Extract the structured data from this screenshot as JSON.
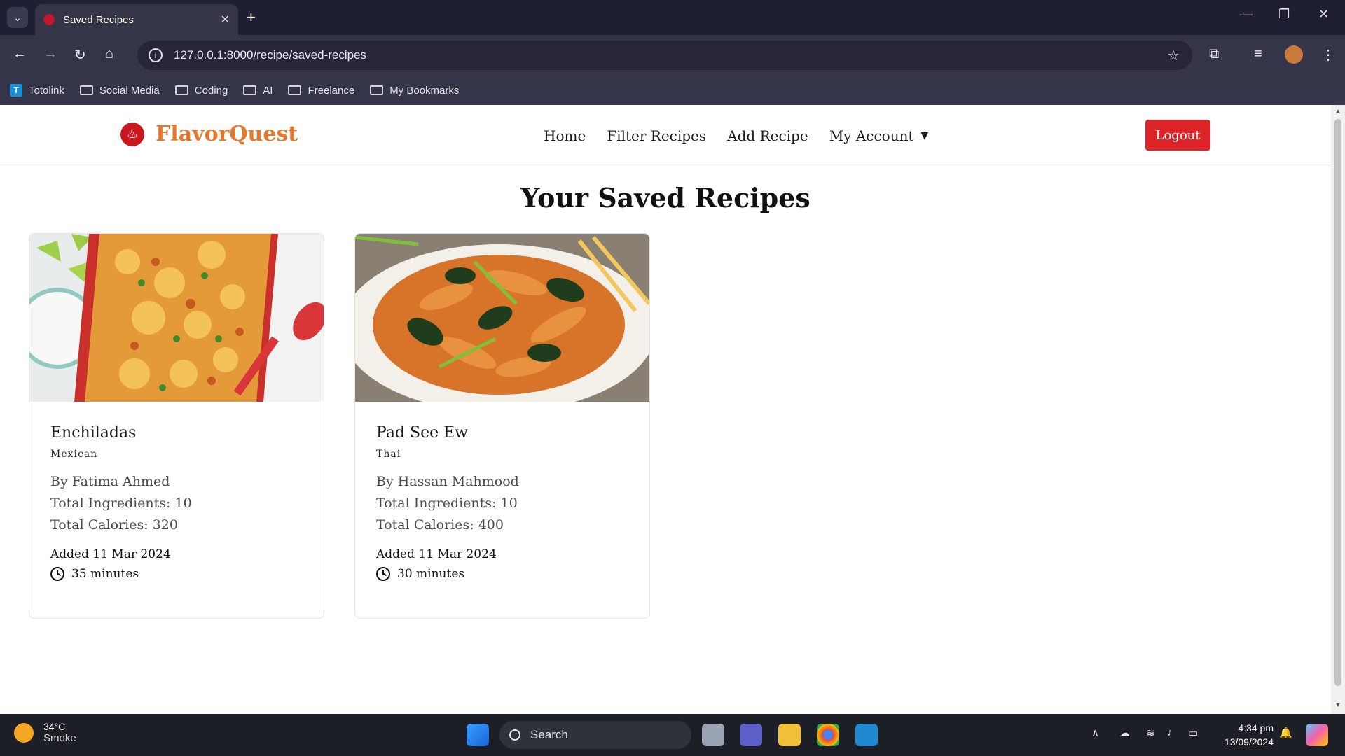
{
  "browser": {
    "tab_title": "Saved Recipes",
    "url": "127.0.0.1:8000/recipe/saved-recipes",
    "bookmarks": [
      {
        "label": "Totolink",
        "icon": "totolink-icon"
      },
      {
        "label": "Social Media",
        "icon": "folder-icon"
      },
      {
        "label": "Coding",
        "icon": "folder-icon"
      },
      {
        "label": "AI",
        "icon": "folder-icon"
      },
      {
        "label": "Freelance",
        "icon": "folder-icon"
      },
      {
        "label": "My Bookmarks",
        "icon": "folder-icon"
      }
    ]
  },
  "site": {
    "brand": "FlavorQuest",
    "brand_color": "#e8762c",
    "nav": {
      "home": "Home",
      "filter": "Filter Recipes",
      "add": "Add Recipe",
      "account": "My Account"
    },
    "logout": "Logout",
    "logout_color": "#dc2327"
  },
  "main": {
    "title": "Your Saved Recipes",
    "recipes": [
      {
        "name": "Enchiladas",
        "cuisine": "Mexican",
        "author": "By Fatima Ahmed",
        "ingredients": "Total Ingredients: 10",
        "calories": "Total Calories: 320",
        "added": "Added 11 Mar 2024",
        "time": "35 minutes"
      },
      {
        "name": "Pad See Ew",
        "cuisine": "Thai",
        "author": "By Hassan Mahmood",
        "ingredients": "Total Ingredients: 10",
        "calories": "Total Calories: 400",
        "added": "Added 11 Mar 2024",
        "time": "30 minutes"
      }
    ]
  },
  "taskbar": {
    "temp": "34°C",
    "weather": "Smoke",
    "search": "Search",
    "time": "4:34 pm",
    "date": "13/09/2024"
  }
}
